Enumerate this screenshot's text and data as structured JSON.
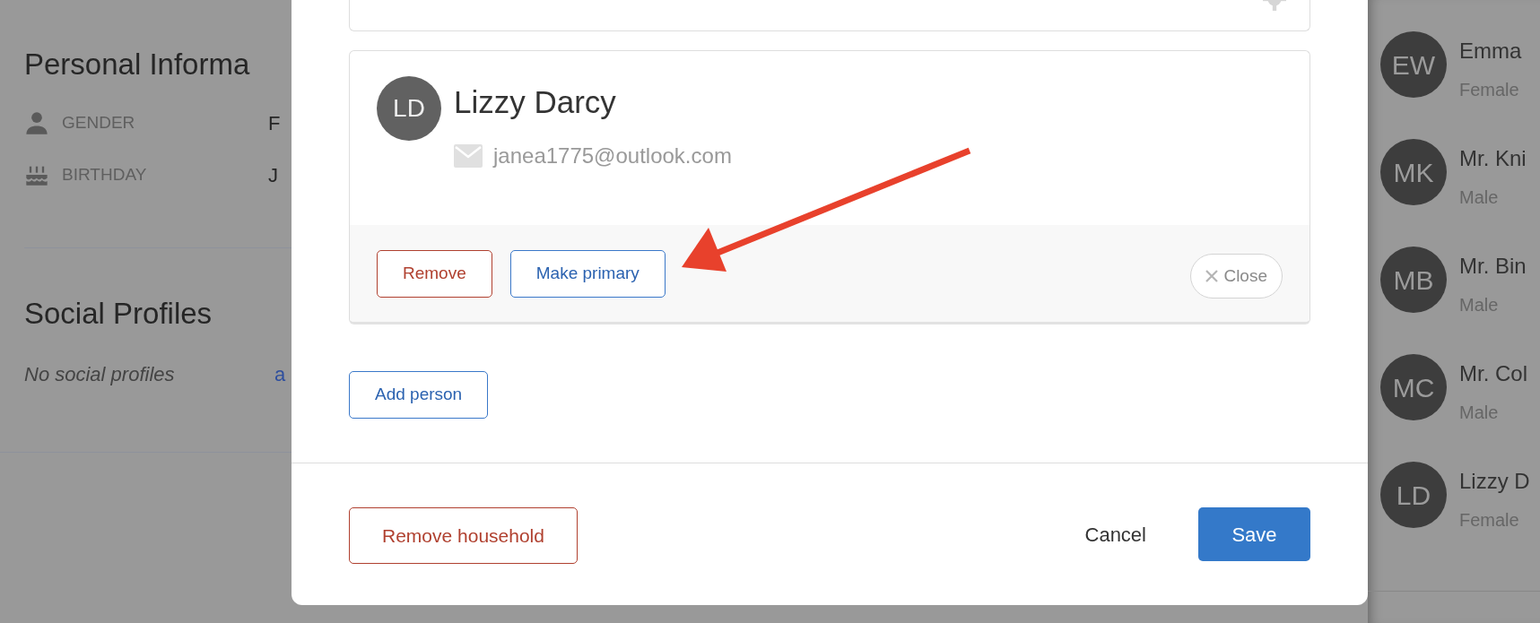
{
  "background_page": {
    "sections": [
      {
        "title": "Personal Informa",
        "fields": [
          {
            "label": "GENDER",
            "value": "F"
          },
          {
            "label": "BIRTHDAY",
            "value": "J"
          }
        ]
      },
      {
        "title": "Social Profiles",
        "empty_text": "No social profiles",
        "link": "a"
      }
    ]
  },
  "modal": {
    "person": {
      "initials": "LD",
      "name": "Lizzy Darcy",
      "email": "janea1775@outlook.com",
      "buttons": [
        {
          "label": "Remove",
          "kind": "danger",
          "disabled": false
        },
        {
          "label": "Make primary",
          "kind": "primary",
          "disabled": false
        },
        {
          "label": "Close",
          "kind": "close",
          "disabled": true
        }
      ]
    },
    "add_button": "Add person",
    "footer": {
      "remove_button": "Remove household",
      "cancel_button": "Cancel",
      "save_button": "Save"
    }
  },
  "people_list": [
    {
      "initials": "EW",
      "name": "Emma",
      "gender": "Female"
    },
    {
      "initials": "MK",
      "name": "Mr. Kni",
      "gender": "Male"
    },
    {
      "initials": "MB",
      "name": "Mr. Bin",
      "gender": "Male"
    },
    {
      "initials": "MC",
      "name": "Mr. Col",
      "gender": "Male"
    },
    {
      "initials": "LD",
      "name": "Lizzy D",
      "gender": "Female"
    }
  ]
}
